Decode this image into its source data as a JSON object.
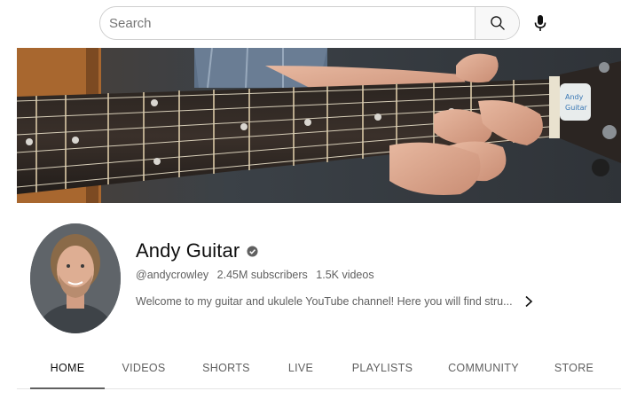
{
  "search": {
    "placeholder": "Search"
  },
  "icons": {
    "search": "search-icon",
    "mic": "microphone-icon",
    "verified": "verified-check-icon",
    "expand": "chevron-right-icon"
  },
  "channel": {
    "name": "Andy Guitar",
    "handle": "@andycrowley",
    "subscribers": "2.45M subscribers",
    "videos": "1.5K videos",
    "description": "Welcome to my guitar and ukulele YouTube channel! Here you will find stru..."
  },
  "tabs": [
    {
      "label": "HOME",
      "active": true
    },
    {
      "label": "VIDEOS",
      "active": false
    },
    {
      "label": "SHORTS",
      "active": false
    },
    {
      "label": "LIVE",
      "active": false
    },
    {
      "label": "PLAYLISTS",
      "active": false
    },
    {
      "label": "COMMUNITY",
      "active": false
    },
    {
      "label": "STORE",
      "active": false
    }
  ],
  "colors": {
    "text_primary": "#0f0f0f",
    "text_secondary": "#606060",
    "border": "#cfcfcf"
  }
}
